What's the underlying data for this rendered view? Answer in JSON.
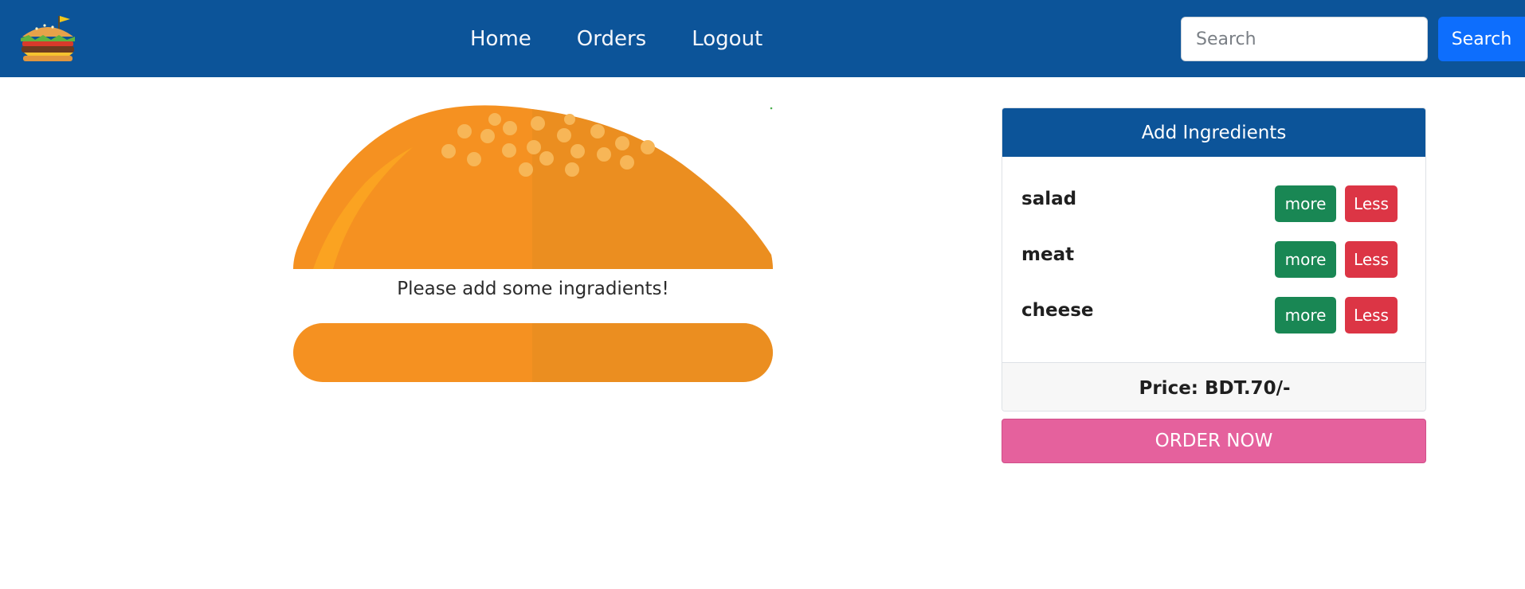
{
  "nav": {
    "links": [
      "Home",
      "Orders",
      "Logout"
    ],
    "search": {
      "placeholder": "Search",
      "value": "",
      "button_label": "Search"
    }
  },
  "burger": {
    "empty_message": "Please add some ingradients!"
  },
  "controls": {
    "title": "Add Ingredients",
    "ingredients": [
      {
        "name": "salad",
        "more_label": "more",
        "less_label": "Less"
      },
      {
        "name": "meat",
        "more_label": "more",
        "less_label": "Less"
      },
      {
        "name": "cheese",
        "more_label": "more",
        "less_label": "Less"
      }
    ],
    "price_text": "Price: BDT.70/-",
    "order_label": "ORDER NOW"
  },
  "colors": {
    "navbar": "#0c5499",
    "bun": "#f59121",
    "more_button": "#198754",
    "less_button": "#dc3545",
    "order_button": "#e5619d",
    "search_button": "#0d6efd"
  }
}
